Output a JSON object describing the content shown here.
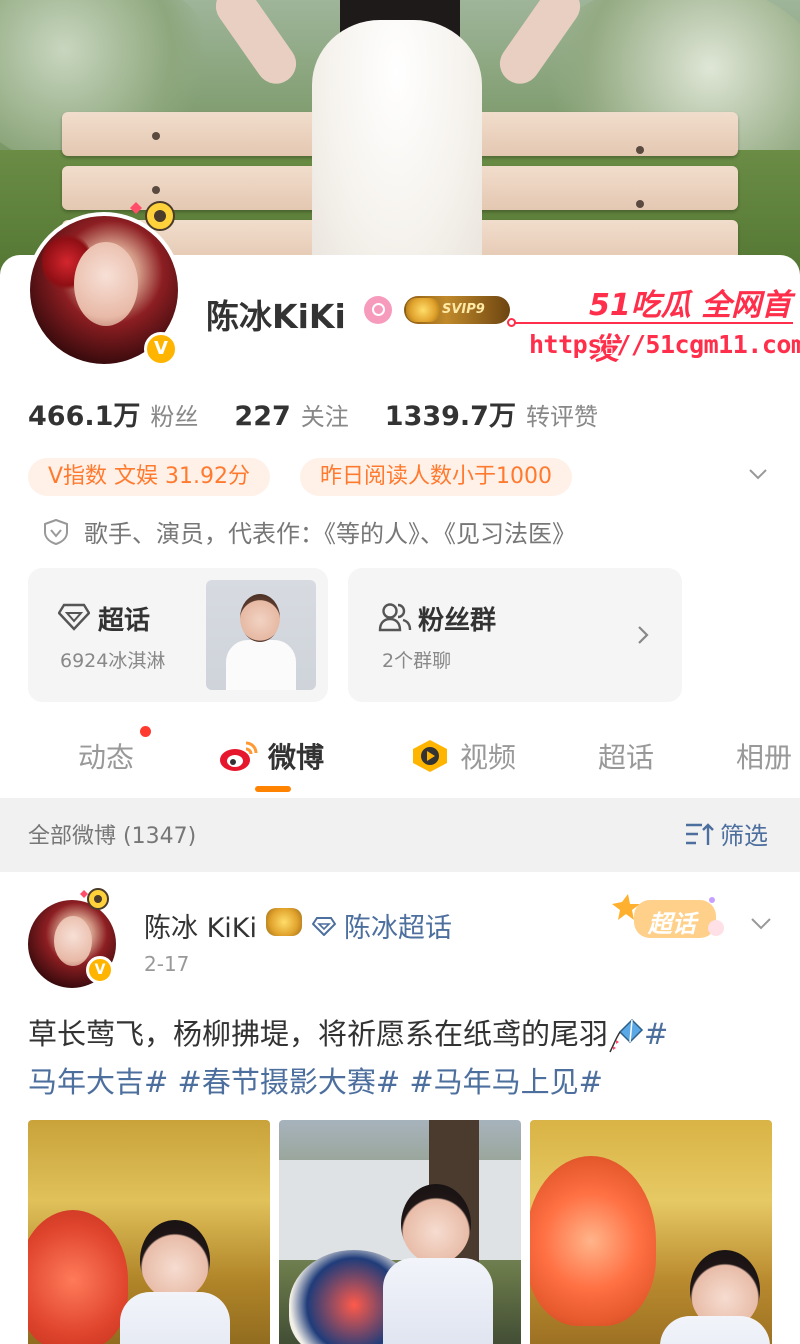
{
  "profile": {
    "name": "陈冰KiKi",
    "svip_label": "SVIP9",
    "stats": [
      {
        "num": "466.1万",
        "label": "粉丝"
      },
      {
        "num": "227",
        "label": "关注"
      },
      {
        "num": "1339.7万",
        "label": "转评赞"
      }
    ],
    "tags": [
      "V指数 文娱 31.92分",
      "昨日阅读人数小于1000"
    ],
    "intro": "歌手、演员，代表作：《等的人》、《见习法医》"
  },
  "watermark": {
    "brand": "51吃瓜 全网首发",
    "url": "https://51cgm11.com"
  },
  "boxes": {
    "chaohua": {
      "title": "超话",
      "sub": "6924冰淇淋"
    },
    "fan_group": {
      "title": "粉丝群",
      "sub": "2个群聊"
    }
  },
  "tabs": [
    {
      "label": "动态",
      "active": false
    },
    {
      "label": "微博",
      "active": true
    },
    {
      "label": "视频",
      "active": false
    },
    {
      "label": "超话",
      "active": false
    },
    {
      "label": "相册",
      "active": false
    }
  ],
  "filter_bar": {
    "count_label": "全部微博 (1347)",
    "filter_label": "筛选"
  },
  "post": {
    "author": "陈冰 KiKi",
    "topic_link": "陈冰超话",
    "date": "2-17",
    "sticker": "超话",
    "text": "草长莺飞，杨柳拂堤，将祈愿系在纸鸢的尾羽",
    "hashtags_line1": "#",
    "hashtags_line2": "马年大吉# #春节摄影大赛# #马年马上见#"
  },
  "colors": {
    "accent_orange": "#ff8200",
    "link_blue": "#4d6f9e",
    "tag_text": "#ff7a2f",
    "tag_bg": "#fff1e8",
    "watermark_red": "#ff2e4a"
  },
  "icons": [
    "search-badge-icon",
    "crown-icon",
    "verified-v-icon",
    "shield-icon",
    "diamond-icon",
    "group-icon",
    "chevron-right-icon",
    "chevron-down-icon",
    "weibo-logo-icon",
    "video-icon",
    "filter-icon",
    "kite-emoji-icon"
  ]
}
